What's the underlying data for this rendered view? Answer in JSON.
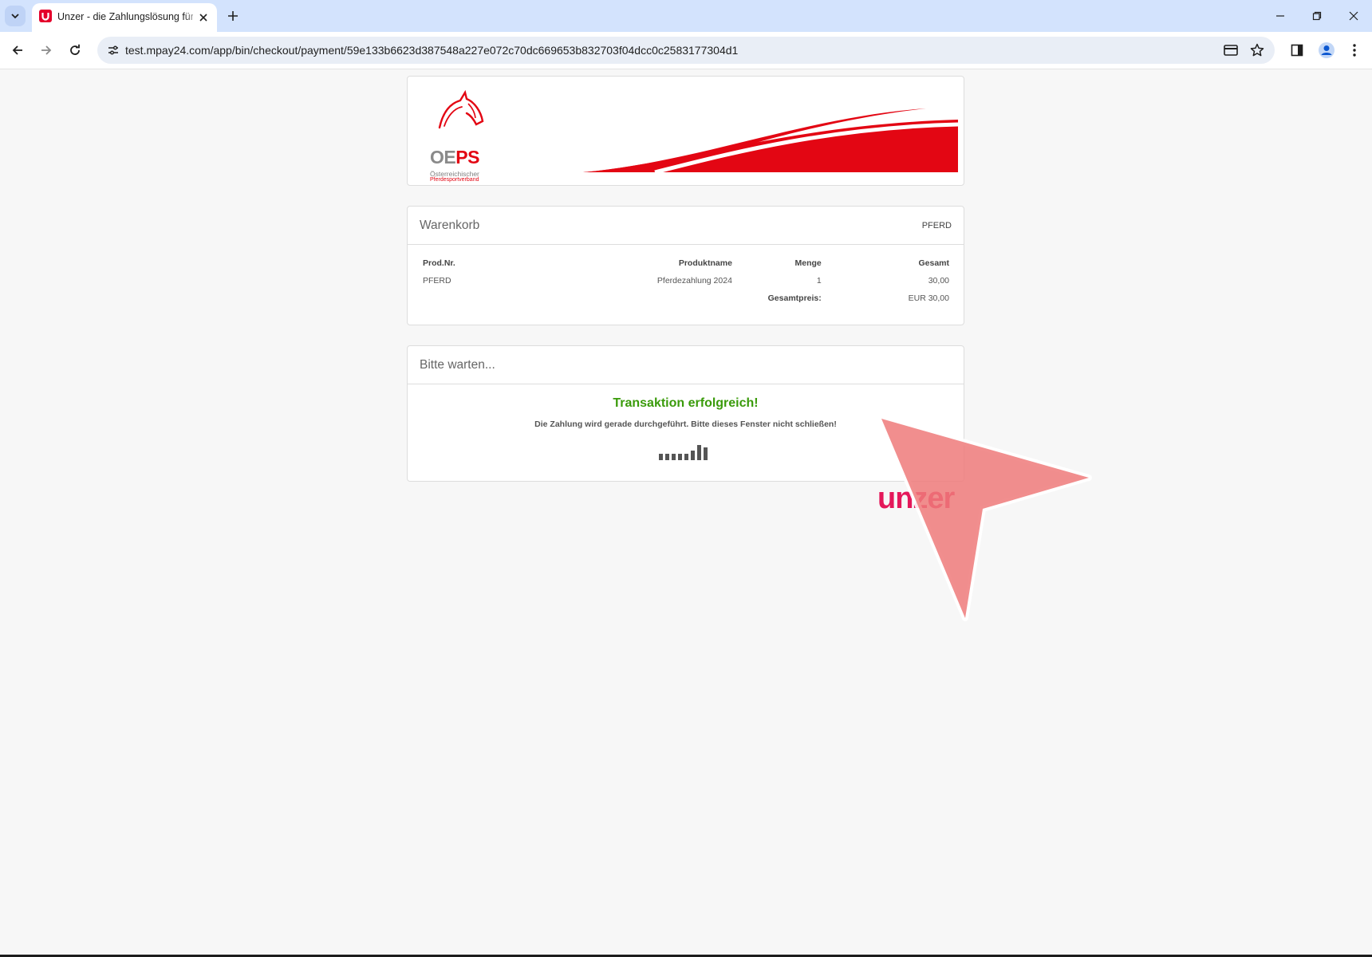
{
  "browser": {
    "tab": {
      "title": "Unzer - die Zahlungslösung für"
    },
    "url": "test.mpay24.com/app/bin/checkout/payment/59e133b6623d387548a227e072c70dc669653b832703f04dcc0c2583177304d1",
    "icons": [
      "tab-list-icon",
      "unzer-favicon",
      "close-icon",
      "new-tab-icon",
      "minimize-icon",
      "restore-icon",
      "close-window-icon",
      "back-icon",
      "forward-icon",
      "reload-icon",
      "site-info-icon",
      "card-icon",
      "star-icon",
      "side-panel-icon",
      "profile-icon",
      "menu-icon"
    ]
  },
  "header": {
    "logo": {
      "mark_oe": "OE",
      "mark_ps": "PS",
      "subtitle_1": "Österreichischer",
      "subtitle_2": "Pferdesportverband"
    },
    "colors": {
      "brand_red": "#e30613"
    }
  },
  "cart": {
    "title": "Warenkorb",
    "reference": "PFERD",
    "columns": [
      "Prod.Nr.",
      "Produktname",
      "Menge",
      "Gesamt"
    ],
    "rows": [
      {
        "prod_nr": "PFERD",
        "name": "Pferdezahlung 2024",
        "qty": "1",
        "total": "30,00"
      }
    ],
    "total_label": "Gesamtpreis:",
    "total_value": "EUR 30,00"
  },
  "status": {
    "title": "Bitte warten...",
    "success": "Transaktion erfolgreich!",
    "message": "Die Zahlung wird gerade durchgeführt. Bitte dieses Fenster nicht schließen!",
    "success_color": "#3a9b0b"
  },
  "footer": {
    "brand": "unzer",
    "brand_color": "#e4185a"
  }
}
